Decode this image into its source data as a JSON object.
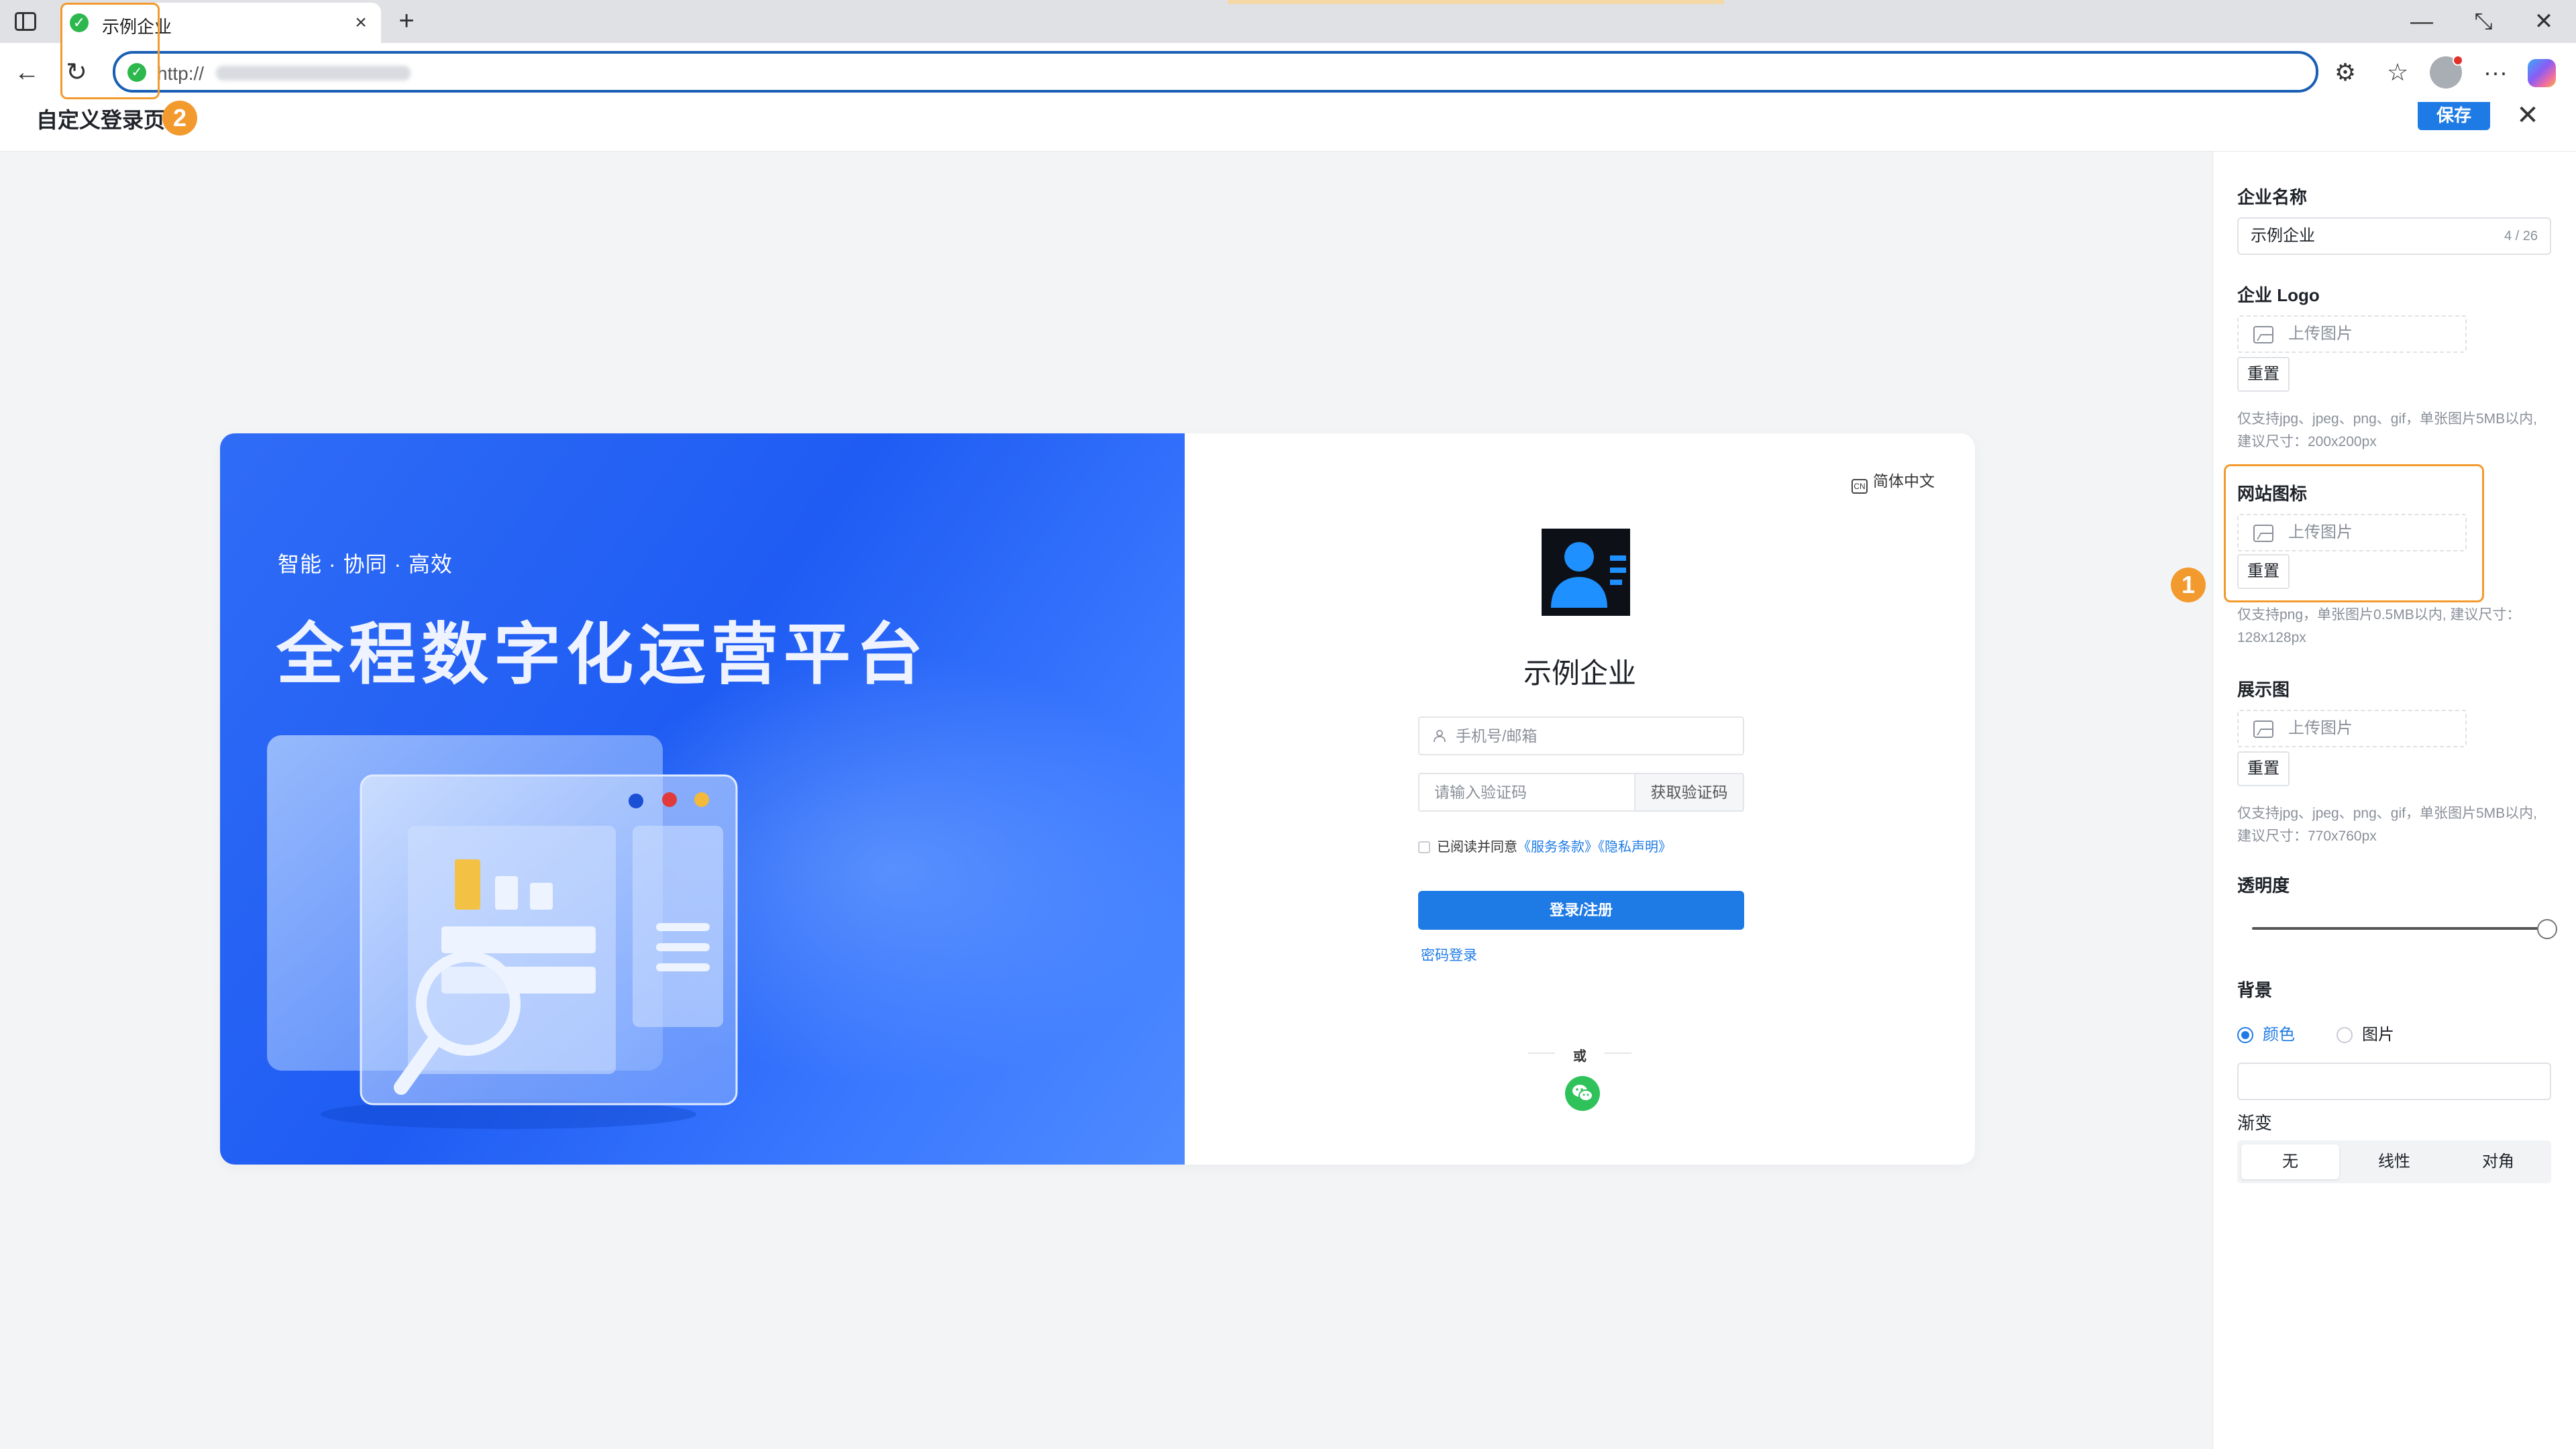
{
  "browser": {
    "tab_title": "示例企业",
    "tab_close": "×",
    "new_tab": "+",
    "url_prefix": "http://",
    "win_minimize": "—",
    "win_restore": "⤡",
    "win_close": "✕",
    "back": "←",
    "reload": "↻",
    "more": "···"
  },
  "header": {
    "title": "自定义登录页",
    "save_label": "保存",
    "close": "✕"
  },
  "annotations": {
    "badge_1": "1",
    "badge_2": "2"
  },
  "hero": {
    "tagline": "智能 · 协同 · 高效",
    "title": "全程数字化运营平台"
  },
  "login": {
    "language": "简体中文",
    "company_name": "示例企业",
    "phone_placeholder": "手机号/邮箱",
    "code_placeholder": "请输入验证码",
    "get_code": "获取验证码",
    "agree_prefix": "已阅读并同意",
    "terms_link": "《服务条款》",
    "privacy_link": "《隐私声明》",
    "submit": "登录/注册",
    "password_login": "密码登录",
    "or": "或"
  },
  "panel": {
    "company_name_label": "企业名称",
    "company_name_value": "示例企业",
    "company_name_counter": "4 / 26",
    "logo_label": "企业 Logo",
    "upload_label": "上传图片",
    "reset_label": "重置",
    "logo_hint": "仅支持jpg、jpeg、png、gif，单张图片5MB以内, 建议尺寸：200x200px",
    "favicon_label": "网站图标",
    "favicon_hint": "仅支持png，单张图片0.5MB以内, 建议尺寸：128x128px",
    "display_label": "展示图",
    "display_hint": "仅支持jpg、jpeg、png、gif，单张图片5MB以内, 建议尺寸：770x760px",
    "opacity_label": "透明度",
    "opacity_value": 1.0,
    "background_label": "背景",
    "bg_color_option": "颜色",
    "bg_image_option": "图片",
    "bg_selected": "颜色",
    "gradient_label": "渐变",
    "gradient_options": [
      "无",
      "线性",
      "对角"
    ],
    "gradient_selected": "无"
  },
  "colors": {
    "accent": "#1e7be6",
    "annotation": "#f39a2f",
    "hero_blue": "#1f5cf3",
    "wechat_green": "#2fc25b",
    "secure_green": "#2db84d"
  }
}
